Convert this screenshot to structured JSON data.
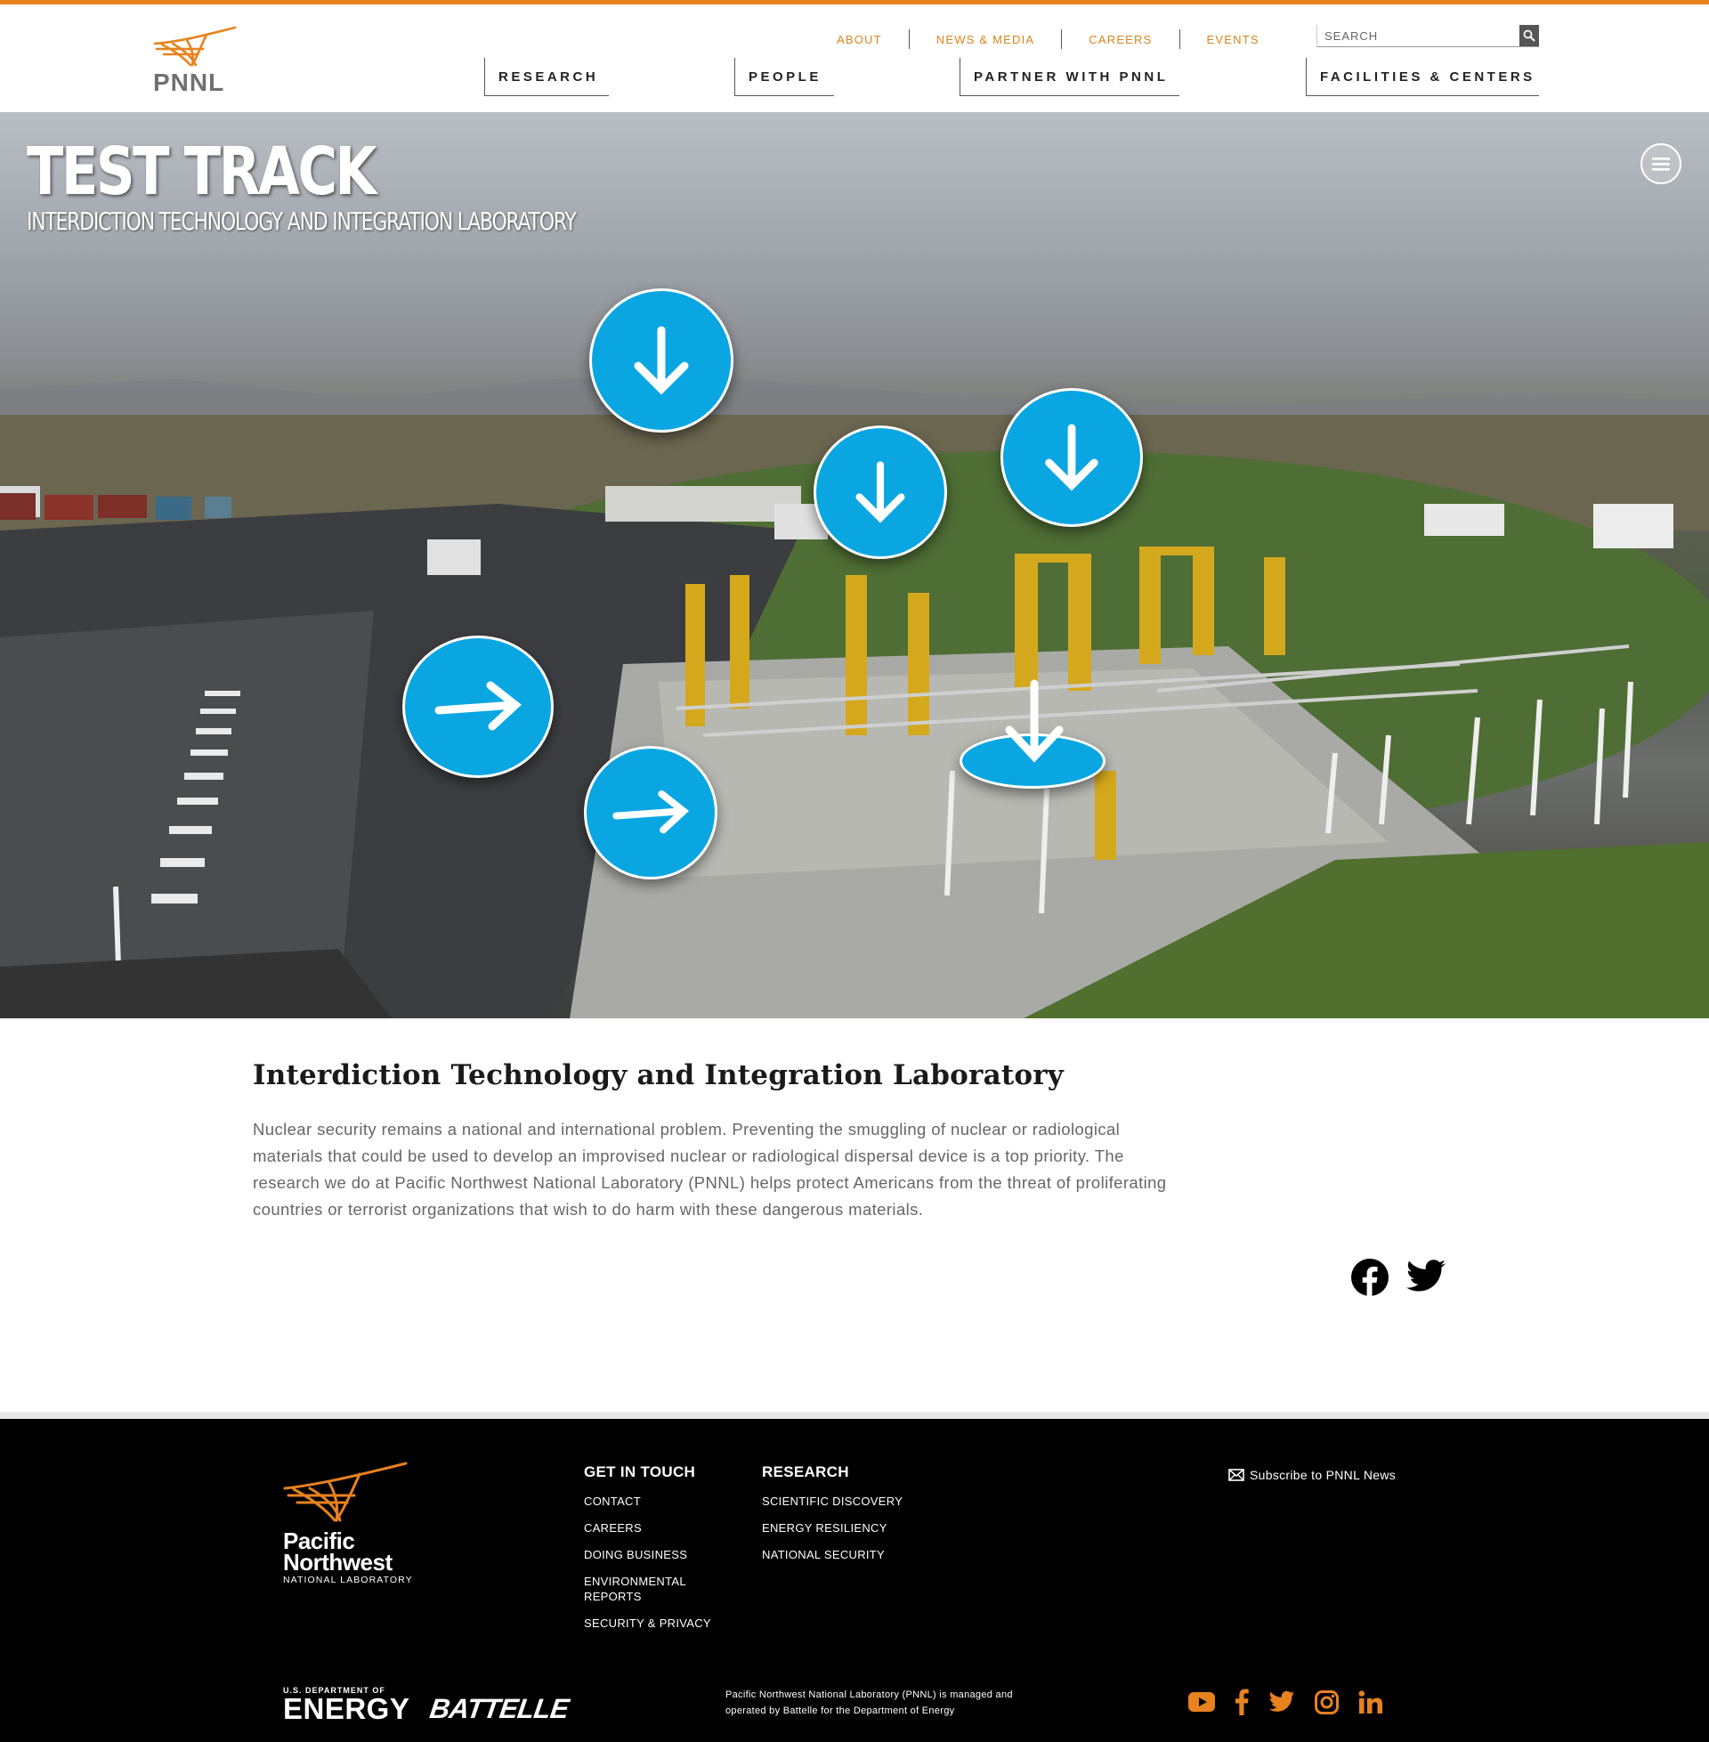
{
  "header": {
    "logo_text": "PNNL",
    "utility_nav": [
      "ABOUT",
      "NEWS & MEDIA",
      "CAREERS",
      "EVENTS"
    ],
    "search_placeholder": "SEARCH",
    "main_nav": [
      "RESEARCH",
      "PEOPLE",
      "PARTNER WITH PNNL",
      "FACILITIES & CENTERS"
    ]
  },
  "hero": {
    "title": "TEST TRACK",
    "subtitle": "INTERDICTION TECHNOLOGY AND INTEGRATION LABORATORY",
    "hotspots": [
      {
        "icon": "arrow-down-icon"
      },
      {
        "icon": "arrow-down-icon"
      },
      {
        "icon": "arrow-down-icon"
      },
      {
        "icon": "arrow-right-icon"
      },
      {
        "icon": "arrow-right-icon"
      },
      {
        "icon": "arrow-down-icon"
      }
    ]
  },
  "content": {
    "heading": "Interdiction Technology and Integration Laboratory",
    "body": "Nuclear security remains a national and international problem. Preventing the smuggling of nuclear or radiological materials that could be used to develop an improvised nuclear or radiological dispersal device is a top priority. The research we do at Pacific Northwest National Laboratory (PNNL) helps protect Americans from the threat of proliferating countries or terrorist organizations that wish to do harm with these dangerous materials.",
    "share_icons": [
      "facebook-icon",
      "twitter-icon"
    ]
  },
  "footer": {
    "logo_line1": "Pacific",
    "logo_line2": "Northwest",
    "logo_line3": "NATIONAL LABORATORY",
    "get_in_touch": {
      "heading": "GET IN TOUCH",
      "links": [
        "CONTACT",
        "CAREERS",
        "DOING BUSINESS",
        "ENVIRONMENTAL REPORTS",
        "SECURITY & PRIVACY"
      ]
    },
    "research": {
      "heading": "RESEARCH",
      "links": [
        "SCIENTIFIC DISCOVERY",
        "ENERGY RESILIENCY",
        "NATIONAL SECURITY"
      ]
    },
    "subscribe": "Subscribe to PNNL News",
    "doe_small": "U.S. DEPARTMENT OF",
    "doe_big": "ENERGY",
    "battelle": "BATTELLE",
    "managed_text": "Pacific Northwest National Laboratory (PNNL) is managed and operated by Battelle for the Department of Energy",
    "social": [
      "youtube-icon",
      "facebook-icon",
      "twitter-icon",
      "instagram-icon",
      "linkedin-icon"
    ]
  },
  "colors": {
    "accent": "#e8821e",
    "hotspot": "#0aa6e2",
    "footer_bg": "#000000"
  }
}
